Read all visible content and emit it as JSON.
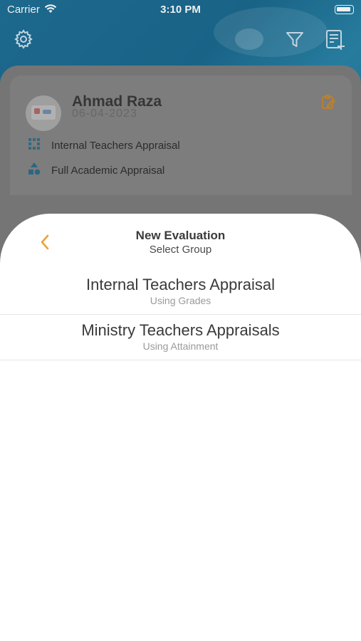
{
  "status_bar": {
    "carrier": "Carrier",
    "time": "3:10 PM"
  },
  "header": {
    "icons": [
      "gear-icon",
      "filter-icon",
      "add-note-icon"
    ]
  },
  "profile": {
    "name": "Ahmad Raza",
    "date": "06-04-2023",
    "rows": [
      {
        "icon": "grid-icon",
        "label": "Internal Teachers Appraisal"
      },
      {
        "icon": "shapes-icon",
        "label": "Full Academic Appraisal"
      }
    ]
  },
  "sheet": {
    "title": "New Evaluation",
    "subtitle": "Select Group",
    "groups": [
      {
        "name": "Internal Teachers Appraisal",
        "method": "Using Grades"
      },
      {
        "name": "Ministry Teachers Appraisals",
        "method": "Using Attainment"
      }
    ]
  },
  "colors": {
    "accent": "#E9A23B",
    "header_blue": "#1F6F96",
    "sheet_bg": "#FFFFFF"
  }
}
